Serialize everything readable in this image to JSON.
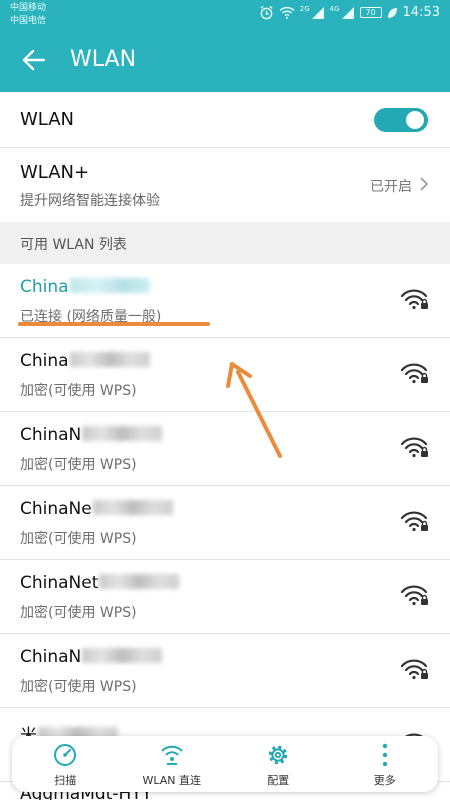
{
  "status_bar": {
    "carrier_1": "中国移动",
    "carrier_2": "中国电信",
    "signal_tag_1": "2G",
    "signal_tag_2": "4G",
    "battery": "70",
    "time": "14:53"
  },
  "header": {
    "title": "WLAN"
  },
  "wlan_toggle": {
    "label": "WLAN",
    "on": true
  },
  "wlan_plus": {
    "label": "WLAN+",
    "subtitle": "提升网络智能连接体验",
    "value": "已开启"
  },
  "section": {
    "label": "可用 WLAN 列表"
  },
  "networks": [
    {
      "name": "China",
      "status": "已连接 (网络质量一般)",
      "connected": true
    },
    {
      "name": "China",
      "status": "加密(可使用 WPS)",
      "connected": false
    },
    {
      "name": "ChinaN",
      "status": "加密(可使用 WPS)",
      "connected": false
    },
    {
      "name": "ChinaNe",
      "status": "加密(可使用 WPS)",
      "connected": false
    },
    {
      "name": "ChinaNet",
      "status": "加密(可使用 WPS)",
      "connected": false
    },
    {
      "name": "ChinaN",
      "status": "加密(可使用 WPS)",
      "connected": false
    },
    {
      "name": "米",
      "status": "",
      "connected": false
    }
  ],
  "cutoff_network": "AggmaMdt-HYY",
  "bottom_tabs": {
    "scan": "扫描",
    "wlan_direct": "WLAN 直连",
    "config": "配置",
    "more": "更多"
  },
  "colors": {
    "accent": "#2ab3bd",
    "connected_text": "#1d9ea8",
    "annotation": "#ec8a3c"
  },
  "icons": {
    "back": "arrow-left-icon",
    "chevron": "chevron-right-icon",
    "wifi_locked": "wifi-lock-icon",
    "scan": "refresh-icon",
    "wlan_direct": "wifi-direct-icon",
    "config": "gear-icon",
    "more": "more-vertical-icon"
  }
}
